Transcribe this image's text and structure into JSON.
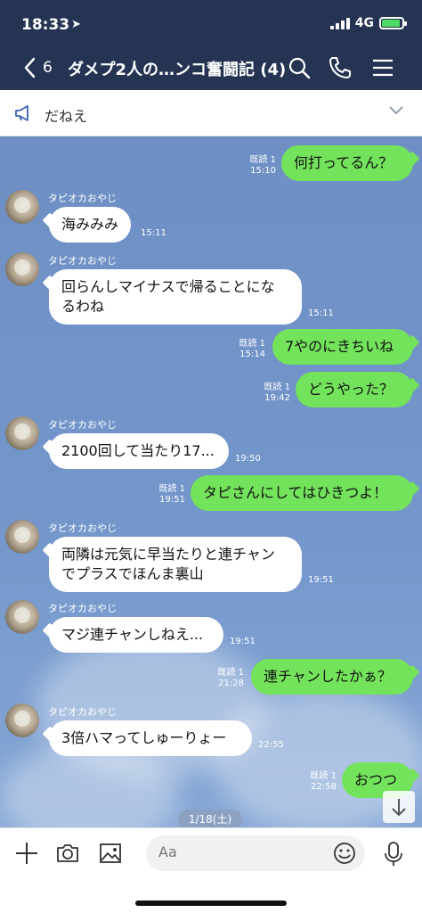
{
  "status_bar": {
    "time": "18:33",
    "network": "4G"
  },
  "nav": {
    "back_count": "6",
    "title": "ダメプ2人の…ンコ奮闘記 (4)"
  },
  "announcement": {
    "text": "だねえ"
  },
  "messages": [
    {
      "side": "out",
      "text": "何打ってるん？",
      "read": "既読 1",
      "time": "15:10"
    },
    {
      "side": "in",
      "sender": "タピオカおやじ",
      "text": "海みみみ",
      "time": "15:11"
    },
    {
      "side": "in",
      "sender": "タピオカおやじ",
      "line1": "回らんしマイナスで帰ることにな",
      "line2": "るわね",
      "time": "15:11"
    },
    {
      "side": "out",
      "text": "7やのにきちいね",
      "read": "既読 1",
      "time": "15:14"
    },
    {
      "side": "out",
      "text": "どうやった？",
      "read": "既読 1",
      "time": "19:42"
    },
    {
      "side": "in",
      "sender": "タピオカおやじ",
      "text": "2100回して当たり17...",
      "time": "19:50"
    },
    {
      "side": "out",
      "text": "タピさんにしてはひきつよ！",
      "read": "既読 1",
      "time": "19:51"
    },
    {
      "side": "in",
      "sender": "タピオカおやじ",
      "line1": "両隣は元気に早当たりと連チャン",
      "line2": "でプラスでほんま裏山",
      "time": "19:51"
    },
    {
      "side": "in",
      "sender": "タピオカおやじ",
      "text": "マジ連チャンしねえ...",
      "time": "19:51"
    },
    {
      "side": "out",
      "text": "連チャンしたかぁ？",
      "read": "既読 1",
      "time": "21:28"
    },
    {
      "side": "in",
      "sender": "タピオカおやじ",
      "text": "3倍ハマってしゅーりょー",
      "time": "22:55"
    },
    {
      "side": "out",
      "text": "おつつ",
      "read": "既読 1",
      "time": "22:58"
    }
  ],
  "date_chip": "1/18(土)",
  "input": {
    "placeholder": "Aa"
  },
  "colors": {
    "header": "#243452",
    "outgoing_bubble": "#74e35c",
    "incoming_bubble": "#ffffff",
    "chat_background": "#7396cb"
  },
  "icons": [
    "back-chevron-icon",
    "search-icon",
    "phone-icon",
    "menu-icon",
    "megaphone-icon",
    "chevron-down-icon",
    "plus-icon",
    "camera-icon",
    "image-icon",
    "emoji-icon",
    "microphone-icon",
    "arrow-down-icon"
  ]
}
